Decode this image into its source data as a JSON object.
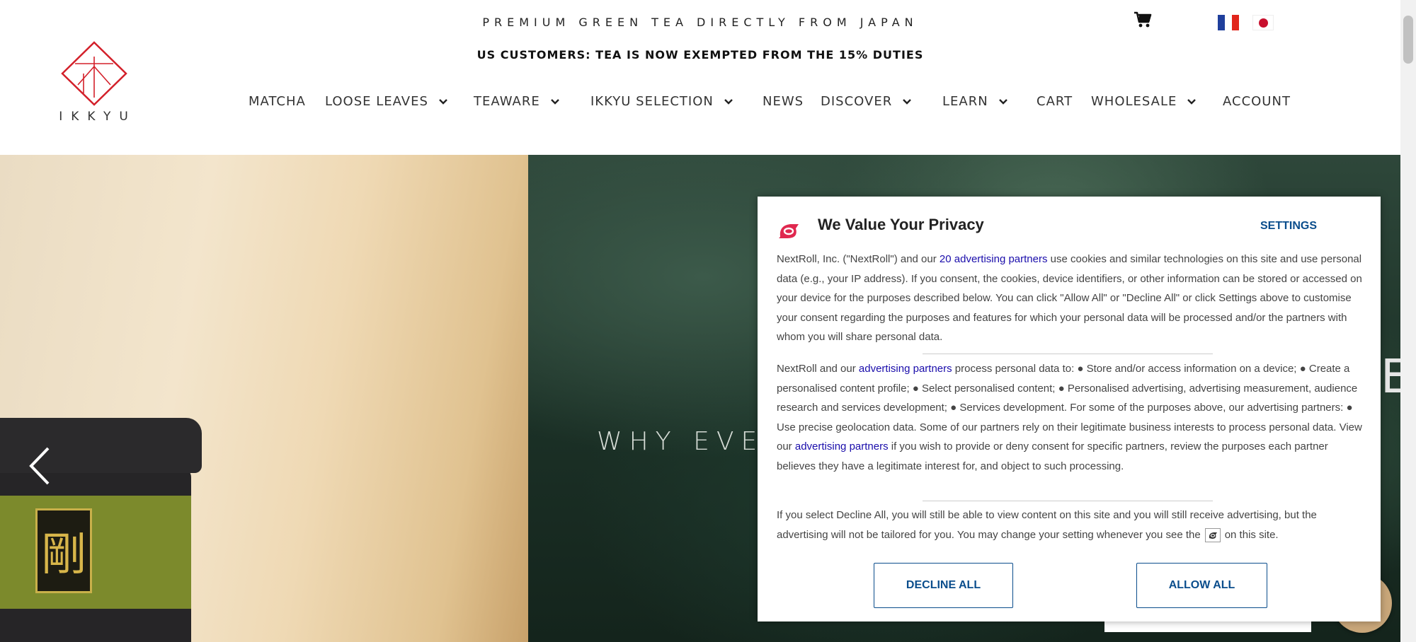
{
  "header": {
    "tagline": "PREMIUM GREEN TEA DIRECTLY FROM JAPAN",
    "notice": "US CUSTOMERS: TEA IS NOW EXEMPTED FROM THE 15% DUTIES",
    "logo_text": "IKKYU",
    "icons": {
      "cart": "cart-icon",
      "flag_fr": "flag-france-icon",
      "flag_jp": "flag-japan-icon"
    }
  },
  "nav": {
    "items": [
      {
        "label": "MATCHA",
        "dropdown": false
      },
      {
        "label": "LOOSE LEAVES",
        "dropdown": true
      },
      {
        "label": "TEAWARE",
        "dropdown": true
      },
      {
        "label": "IKKYU SELECTION",
        "dropdown": true
      },
      {
        "label": "NEWS",
        "dropdown": false
      },
      {
        "label": "DISCOVER",
        "dropdown": true
      },
      {
        "label": "LEARN",
        "dropdown": true
      },
      {
        "label": "CART",
        "dropdown": false
      },
      {
        "label": "WHOLESALE",
        "dropdown": true
      },
      {
        "label": "ACCOUNT",
        "dropdown": false
      }
    ]
  },
  "hero": {
    "caption": "WHY EVE",
    "caption_right": "E",
    "tin_kanji": "剛"
  },
  "privacy": {
    "title": "We Value Your Privacy",
    "settings_label": "SETTINGS",
    "p1": {
      "before": "NextRoll, Inc. (\"NextRoll\") and our ",
      "link": "20 advertising partners",
      "after": " use cookies and similar technologies on this site and use personal data (e.g., your IP address). If you consent, the cookies, device identifiers, or other information can be stored or accessed on your device for the purposes described below. You can click \"Allow All\" or \"Decline All\" or click Settings above to customise your consent regarding the purposes and features for which your personal data will be processed and/or the partners with whom you will share personal data."
    },
    "p2": {
      "before": "NextRoll and our ",
      "link1": "advertising partners",
      "middle": " process personal data to: ● Store and/or access information on a device; ● Create a personalised content profile; ● Select personalised content; ● Personalised advertising, advertising measurement, audience research and services development; ● Services development. For some of the purposes above, our advertising partners: ● Use precise geolocation data. Some of our partners rely on their legitimate business interests to process personal data. View our ",
      "link2": "advertising partners",
      "after": " if you wish to provide or deny consent for specific partners, review the purposes each partner believes they have a legitimate interest for, and object to such processing."
    },
    "p3": {
      "before": "If you select Decline All, you will still be able to view content on this site and you will still receive advertising, but the advertising will not be tailored for you. You may change your setting whenever you see the",
      "after": "on this site."
    },
    "decline_label": "DECLINE ALL",
    "allow_label": "ALLOW ALL",
    "accent_color": "#0a4d8c",
    "brand_color": "#e0284f"
  }
}
